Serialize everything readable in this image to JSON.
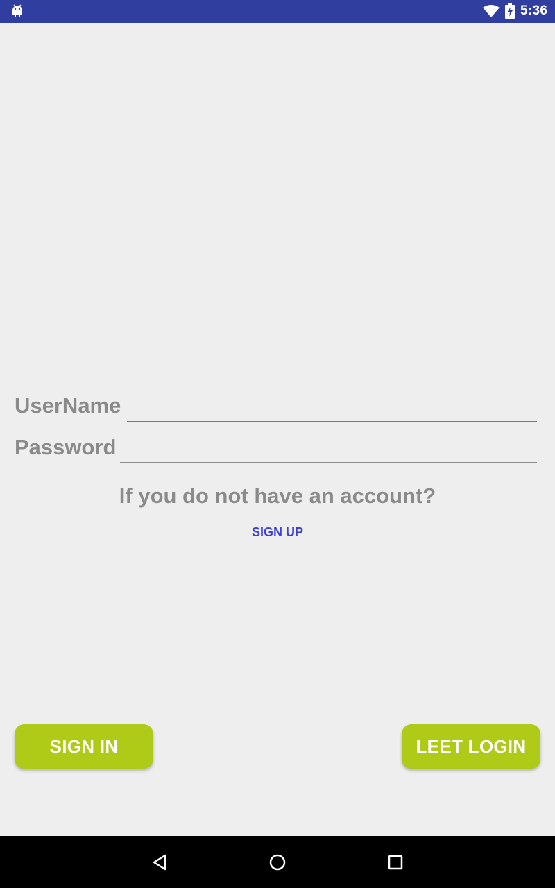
{
  "status_bar": {
    "time": "5:36",
    "icons": [
      "android-icon",
      "wifi-icon",
      "battery-charging-icon"
    ],
    "color": "#303f9f"
  },
  "login_form": {
    "username_label": "UserName",
    "username_value": "",
    "password_label": "Password",
    "password_value": "",
    "account_prompt": "If you do not have an account?",
    "signup_link": "SIGN UP"
  },
  "buttons": {
    "sign_in": "SIGN IN",
    "leet_login": "LEET LOGIN"
  },
  "navigation_bar": {
    "icons": [
      "back-icon",
      "home-icon",
      "recents-icon"
    ]
  },
  "colors": {
    "accent": "#e84083",
    "button": "#afca17",
    "link": "#3f3fd6",
    "label": "#8a8a8a",
    "background": "#eeeeee"
  }
}
